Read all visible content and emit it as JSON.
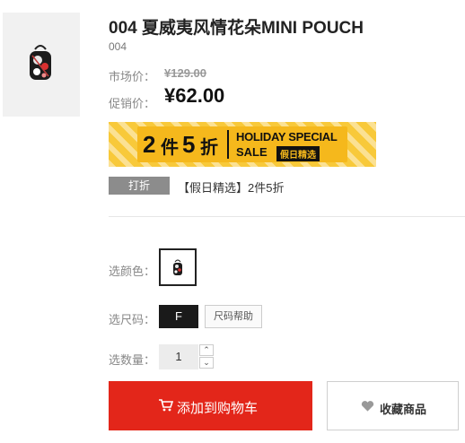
{
  "product": {
    "title": "004 夏威夷风情花朵MINI POUCH",
    "code": "004"
  },
  "pricing": {
    "market_label": "市场价：",
    "market_price": "¥129.00",
    "promo_label": "促销价：",
    "promo_price": "¥62.00"
  },
  "banner": {
    "n1": "2",
    "w1": "件",
    "n2": "5",
    "w2": "折",
    "line1": "HOLIDAY SPECIAL",
    "line2": "SALE",
    "tag": "假日精选"
  },
  "promotion": {
    "tag": "打折",
    "text": "【假日精选】2件5折"
  },
  "options": {
    "color_label": "选颜色：",
    "size_label": "选尺码：",
    "size_value": "F",
    "size_help": "尺码帮助",
    "qty_label": "选数量：",
    "qty_value": "1",
    "qty_up": "⌃",
    "qty_down": "⌄"
  },
  "actions": {
    "add_to_cart": "添加到购物车",
    "favorite": "收藏商品"
  },
  "colors": {
    "accent": "#e3261a",
    "banner_yellow": "#f8c93a",
    "tag_gray": "#8c8c8c"
  },
  "icons": {
    "cart": "cart-icon",
    "heart": "heart-icon"
  }
}
